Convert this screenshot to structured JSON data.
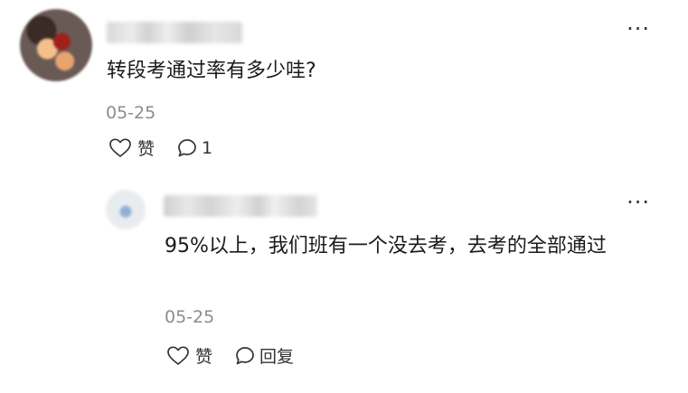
{
  "comment": {
    "text": "转段考通过率有多少哇?",
    "date": "05-25",
    "like_label": "赞",
    "reply_count": "1",
    "more_label": "···"
  },
  "reply": {
    "text": "95%以上，我们班有一个没去考，去考的全部通过",
    "date": "05-25",
    "like_label": "赞",
    "reply_label": "回复",
    "more_label": "···"
  },
  "icons": {
    "like": "heart-outline-icon",
    "comment": "speech-bubble-icon",
    "more": "more-horizontal-icon"
  },
  "colors": {
    "text": "#1a1a1a",
    "muted": "#8c8c8c",
    "background": "#ffffff"
  }
}
